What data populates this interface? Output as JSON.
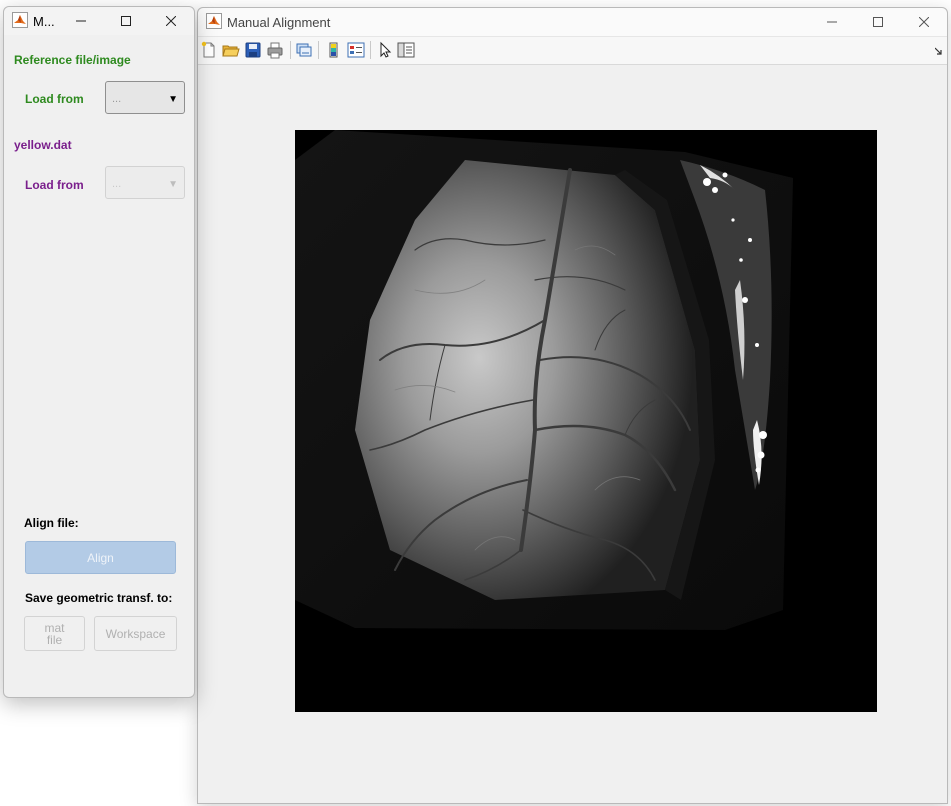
{
  "panel_window": {
    "title": "M...",
    "reference_section": "Reference file/image",
    "reference_load_label": "Load from",
    "reference_dropdown_value": "...",
    "file_section": "yellow.dat",
    "file_load_label": "Load from",
    "file_dropdown_value": "...",
    "align_heading": "Align file:",
    "align_button": "Align",
    "save_heading": "Save geometric transf. to:",
    "mat_file_button": "mat\nfile",
    "workspace_button": "Workspace"
  },
  "main_window": {
    "title": "Manual Alignment",
    "toolbar_icons": [
      "new-figure-icon",
      "open-icon",
      "save-icon",
      "print-icon",
      "link-plot-icon",
      "insert-colorbar-icon",
      "insert-legend-icon",
      "edit-plot-icon",
      "property-inspector-icon"
    ]
  },
  "colors": {
    "reference_green": "#2e8a1f",
    "file_purple": "#7a1f8c",
    "align_button_disabled_blue": "#b3cbe6"
  }
}
